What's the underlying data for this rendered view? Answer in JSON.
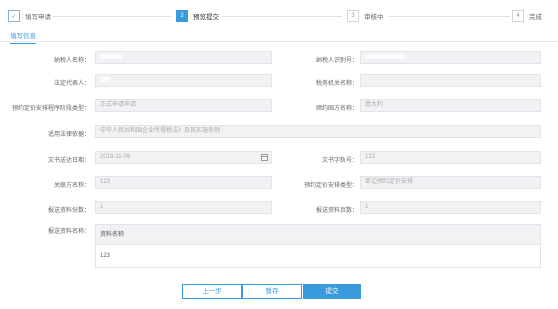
{
  "steps": [
    {
      "num": "✓",
      "label": "填写申请"
    },
    {
      "num": "2",
      "label": "预览提交"
    },
    {
      "num": "3",
      "label": "审核中"
    },
    {
      "num": "4",
      "label": "完成"
    }
  ],
  "tab": {
    "label": "填写信息"
  },
  "form": {
    "taxpayer_name_label": "纳税人名称：",
    "taxpayer_id_label": "纳税人识别号：",
    "legal_rep_label": "法定代表人：",
    "tax_authority_label": "税务机关名称：",
    "apa_stage_label": "预约定价安排程序阶段类型：",
    "counterparty_country_label": "缔约国方名称：",
    "apa_stage_value": "正式申请申请",
    "counterparty_country_value": "意大利",
    "legal_basis_label": "适用法律依据：",
    "legal_basis_value": "中华人民共和国企业所得税法》及其实施条例",
    "doc_date_label": "文书送达日期：",
    "doc_date_value": "2018-11-09",
    "doc_number_label": "文书字轨号：",
    "doc_number_value": "123",
    "related_party_label": "关联方名称：",
    "related_party_value": "123",
    "apa_type_label": "预约定价安排类型：",
    "apa_type_value": "单边预约定价安排",
    "copies_label": "报送资料份数：",
    "copies_value": "1",
    "pages_label": "报送资料页数：",
    "pages_value": "1",
    "materials_label": "报送资料名称："
  },
  "materials_table": {
    "header": "资料名称",
    "rows": [
      "123"
    ]
  },
  "buttons": {
    "prev": "上一步",
    "save": "暂存",
    "submit": "提交"
  },
  "colors": {
    "accent": "#3a9bdc",
    "field_bg": "#f0f2f4"
  }
}
